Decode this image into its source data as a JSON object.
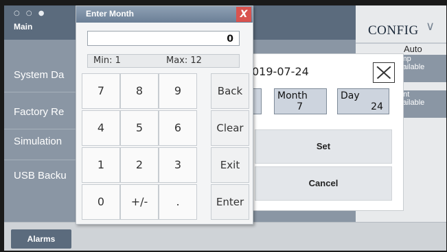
{
  "main_tab": {
    "dots": "○ ○ ●",
    "label": "Main"
  },
  "menu": [
    "System Da",
    "Factory Re",
    "Simulation",
    "USB Backu"
  ],
  "config": {
    "title": "CONFIG",
    "mode": "Auto",
    "buttons": [
      {
        "line1": "imp",
        "line2": "vailable"
      },
      {
        "line1": "ent",
        "line2": "vailable"
      }
    ]
  },
  "bottom": {
    "alarms_label": "Alarms"
  },
  "date_dialog": {
    "date_text": "019-07-24",
    "fields": [
      {
        "label": "",
        "value": ""
      },
      {
        "label": "Month",
        "value": "7"
      },
      {
        "label": "Day",
        "value": "24"
      }
    ],
    "set_label": "Set",
    "cancel_label": "Cancel"
  },
  "keypad": {
    "title": "Enter Month",
    "close_glyph": "X",
    "value": "0",
    "min_label": "Min: 1",
    "max_label": "Max: 12",
    "keys": [
      "7",
      "8",
      "9",
      "4",
      "5",
      "6",
      "1",
      "2",
      "3",
      "0",
      "+/-",
      "."
    ],
    "fn_keys": [
      "Back",
      "Clear",
      "Exit",
      "Enter"
    ]
  }
}
